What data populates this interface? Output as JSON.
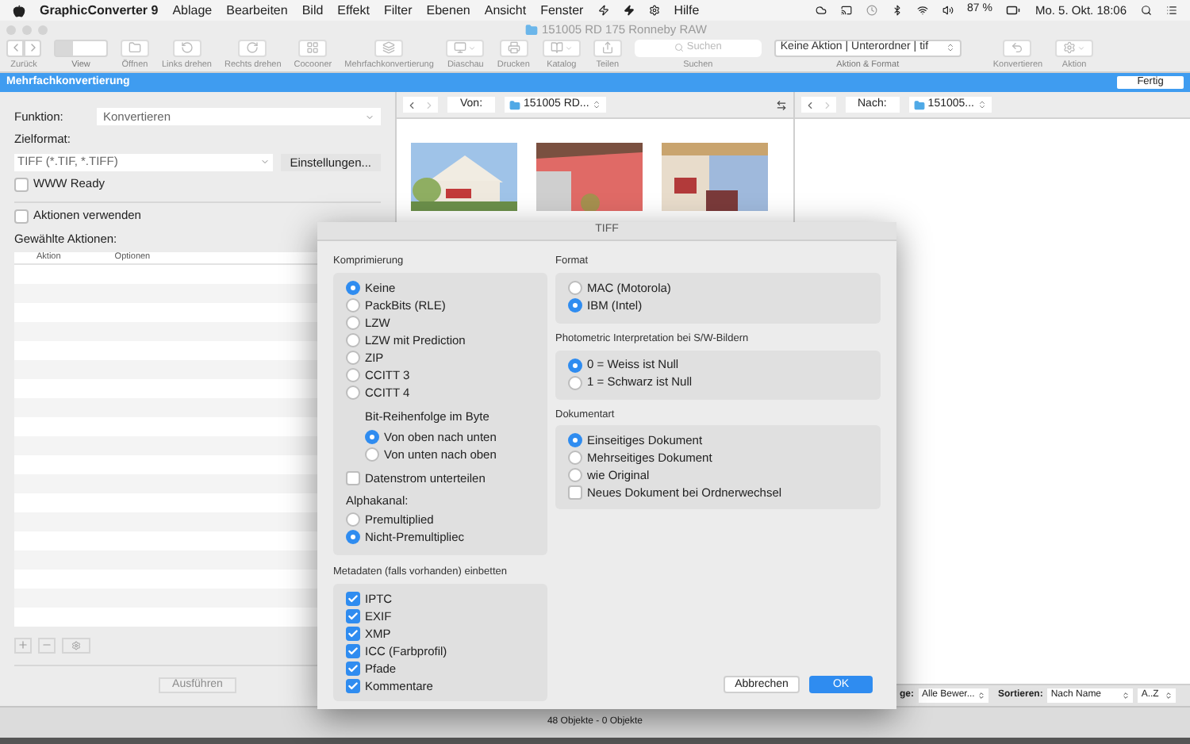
{
  "menubar": {
    "app_name": "GraphicConverter 9",
    "menus": [
      "Ablage",
      "Bearbeiten",
      "Bild",
      "Effekt",
      "Filter",
      "Ebenen",
      "Ansicht",
      "Fenster",
      "Hilfe"
    ],
    "battery": "87 %",
    "clock": "Mo. 5. Okt. 18:06"
  },
  "window": {
    "title": "151005 RD 175 Ronneby RAW",
    "toolbar": [
      {
        "label": "Zurück",
        "kind": "nav"
      },
      {
        "label": "View",
        "kind": "view"
      },
      {
        "label": "Öffnen",
        "kind": "icon"
      },
      {
        "label": "Links drehen",
        "kind": "icon"
      },
      {
        "label": "Rechts drehen",
        "kind": "icon"
      },
      {
        "label": "Cocooner",
        "kind": "icon"
      },
      {
        "label": "Mehrfachkonvertierung",
        "kind": "icon"
      },
      {
        "label": "Diaschau",
        "kind": "popup"
      },
      {
        "label": "Drucken",
        "kind": "icon"
      },
      {
        "label": "Katalog",
        "kind": "popup"
      },
      {
        "label": "Teilen",
        "kind": "icon"
      },
      {
        "label": "Suchen",
        "kind": "search",
        "placeholder": "Suchen"
      },
      {
        "label": "Aktion & Format",
        "kind": "select",
        "value": "Keine Aktion | Unterordner | tif"
      },
      {
        "label": "Konvertieren",
        "kind": "icon"
      },
      {
        "label": "Aktion",
        "kind": "popup"
      }
    ]
  },
  "batch_bar": {
    "title": "Mehrfachkonvertierung",
    "done_button": "Fertig"
  },
  "left_panel": {
    "function_label": "Funktion:",
    "function_value": "Konvertieren",
    "target_label": "Zielformat:",
    "target_value": "TIFF (*.TIF, *.TIFF)",
    "settings_button": "Einstellungen...",
    "www_ready": {
      "label": "WWW Ready",
      "checked": false
    },
    "use_actions": {
      "label": "Aktionen verwenden",
      "checked": false
    },
    "chosen_label": "Gewählte Aktionen:",
    "columns": [
      "Aktion",
      "Optionen"
    ],
    "run_button": "Ausführen"
  },
  "browser": {
    "source": {
      "label": "Von:",
      "folder": "151005 RD..."
    },
    "destination": {
      "label": "Nach:",
      "folder": "151005..."
    },
    "sort_bar": {
      "rating_label": "ge:",
      "rating_value": "Alle Bewer...",
      "sort_label": "Sortieren:",
      "sort_value": "Nach Name",
      "order_value": "A..Z"
    }
  },
  "status_bar": "48 Objekte - 0 Objekte",
  "dialog": {
    "title": "TIFF",
    "compression": {
      "label": "Komprimierung",
      "options": [
        {
          "label": "Keine",
          "selected": true
        },
        {
          "label": "PackBits (RLE)",
          "selected": false
        },
        {
          "label": "LZW",
          "selected": false
        },
        {
          "label": "LZW mit Prediction",
          "selected": false
        },
        {
          "label": "ZIP",
          "selected": false
        },
        {
          "label": "CCITT 3",
          "selected": false
        },
        {
          "label": "CCITT 4",
          "selected": false
        }
      ],
      "bit_order": {
        "label": "Bit-Reihenfolge im Byte",
        "options": [
          {
            "label": "Von oben nach unten",
            "selected": true
          },
          {
            "label": "Von unten nach oben",
            "selected": false
          }
        ]
      },
      "split_stream": {
        "label": "Datenstrom unterteilen",
        "checked": false
      },
      "alpha": {
        "label": "Alphakanal:",
        "options": [
          {
            "label": "Premultiplied",
            "selected": false
          },
          {
            "label": "Nicht-Premultipliec",
            "selected": true
          }
        ]
      }
    },
    "metadata": {
      "label": "Metadaten (falls vorhanden) einbetten",
      "items": [
        {
          "label": "IPTC",
          "checked": true
        },
        {
          "label": "EXIF",
          "checked": true
        },
        {
          "label": "XMP",
          "checked": true
        },
        {
          "label": "ICC (Farbprofil)",
          "checked": true
        },
        {
          "label": "Pfade",
          "checked": true
        },
        {
          "label": "Kommentare",
          "checked": true
        }
      ]
    },
    "format": {
      "label": "Format",
      "options": [
        {
          "label": "MAC (Motorola)",
          "selected": false
        },
        {
          "label": "IBM (Intel)",
          "selected": true
        }
      ]
    },
    "photometric": {
      "label": "Photometric Interpretation bei S/W-Bildern",
      "options": [
        {
          "label": "0 = Weiss ist Null",
          "selected": true
        },
        {
          "label": "1 = Schwarz ist Null",
          "selected": false
        }
      ]
    },
    "document": {
      "label": "Dokumentart",
      "options": [
        {
          "label": "Einseitiges Dokument",
          "selected": true
        },
        {
          "label": "Mehrseitiges Dokument",
          "selected": false
        },
        {
          "label": "wie Original",
          "selected": false
        }
      ],
      "new_on_folder_change": {
        "label": "Neues Dokument bei Ordnerwechsel",
        "checked": false
      }
    },
    "cancel_button": "Abbrechen",
    "ok_button": "OK"
  }
}
